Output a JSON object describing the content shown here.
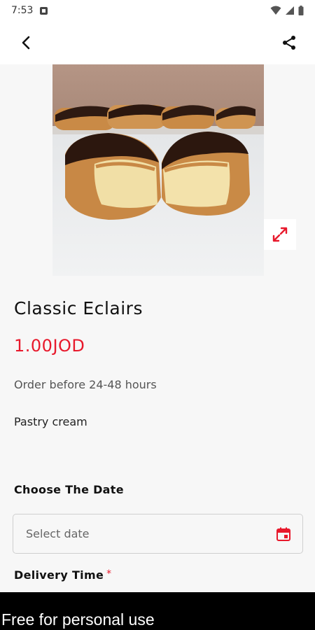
{
  "status_bar": {
    "time": "7:53"
  },
  "toolbar": {
    "back_icon": "chevron-left-icon",
    "share_icon": "share-icon"
  },
  "product": {
    "image_alt": "eclairs-photo",
    "title": "Classic Eclairs",
    "price": "1.00JOD",
    "order_note": "Order before 24-48 hours",
    "description": "Pastry cream"
  },
  "date_section": {
    "label": "Choose The Date",
    "placeholder": "Select date"
  },
  "delivery_section": {
    "label": "Delivery Time",
    "required_mark": "*"
  },
  "watermark": {
    "text": "Free for personal use"
  },
  "colors": {
    "accent": "#e8192c",
    "background": "#f7f7f7"
  }
}
